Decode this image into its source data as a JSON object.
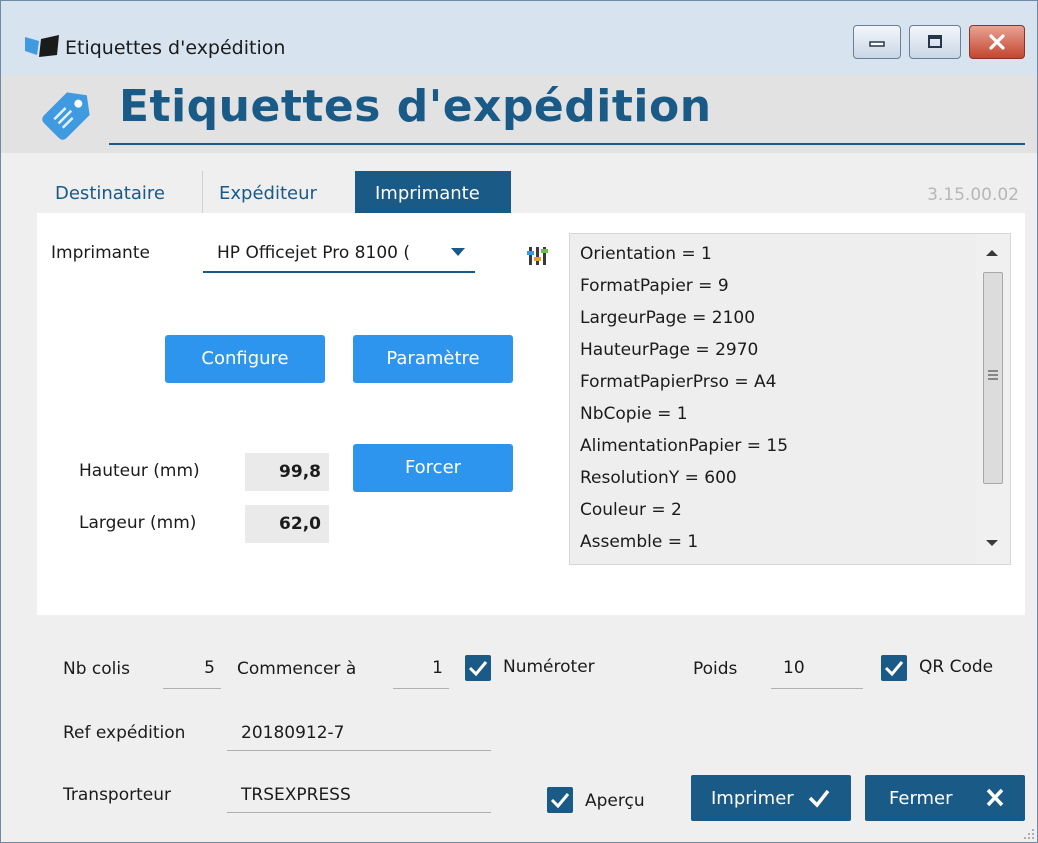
{
  "window": {
    "title": "Etiquettes d'expédition",
    "controls": [
      "minimize-icon",
      "maximize-icon",
      "close-icon"
    ]
  },
  "header": {
    "title": "Etiquettes d'expédition",
    "icon": "tag-icon"
  },
  "version": "3.15.00.02",
  "tabs": [
    {
      "label": "Destinataire",
      "active": false
    },
    {
      "label": "Expéditeur",
      "active": false
    },
    {
      "label": "Imprimante",
      "active": true
    }
  ],
  "printer": {
    "label": "Imprimante",
    "selected": "HP Officejet Pro 8100 (",
    "configure_label": "Configure",
    "parametre_label": "Paramètre",
    "forcer_label": "Forcer",
    "hauteur_label": "Hauteur (mm)",
    "hauteur_value": "99,8",
    "largeur_label": "Largeur (mm)",
    "largeur_value": "62,0",
    "properties": [
      "Orientation = 1",
      "FormatPapier = 9",
      "LargeurPage = 2100",
      "HauteurPage = 2970",
      "FormatPapierPrso = A4",
      "NbCopie = 1",
      "AlimentationPapier = 15",
      "ResolutionY = 600",
      "Couleur = 2",
      "Assemble = 1"
    ]
  },
  "footer": {
    "nb_colis_label": "Nb colis",
    "nb_colis_value": "5",
    "commencer_label": "Commencer à",
    "commencer_value": "1",
    "numeroter_label": "Numéroter",
    "numeroter_checked": true,
    "poids_label": "Poids",
    "poids_value": "10",
    "qrcode_label": "QR Code",
    "qrcode_checked": true,
    "ref_label": "Ref expédition",
    "ref_value": "20180912-7",
    "transporteur_label": "Transporteur",
    "transporteur_value": "TRSEXPRESS",
    "apercu_label": "Aperçu",
    "apercu_checked": true,
    "imprimer_label": "Imprimer",
    "fermer_label": "Fermer"
  },
  "colors": {
    "brand_dark": "#1a5a87",
    "button_blue": "#2d95ee",
    "header_icon_blue": "#3f9ae0"
  }
}
